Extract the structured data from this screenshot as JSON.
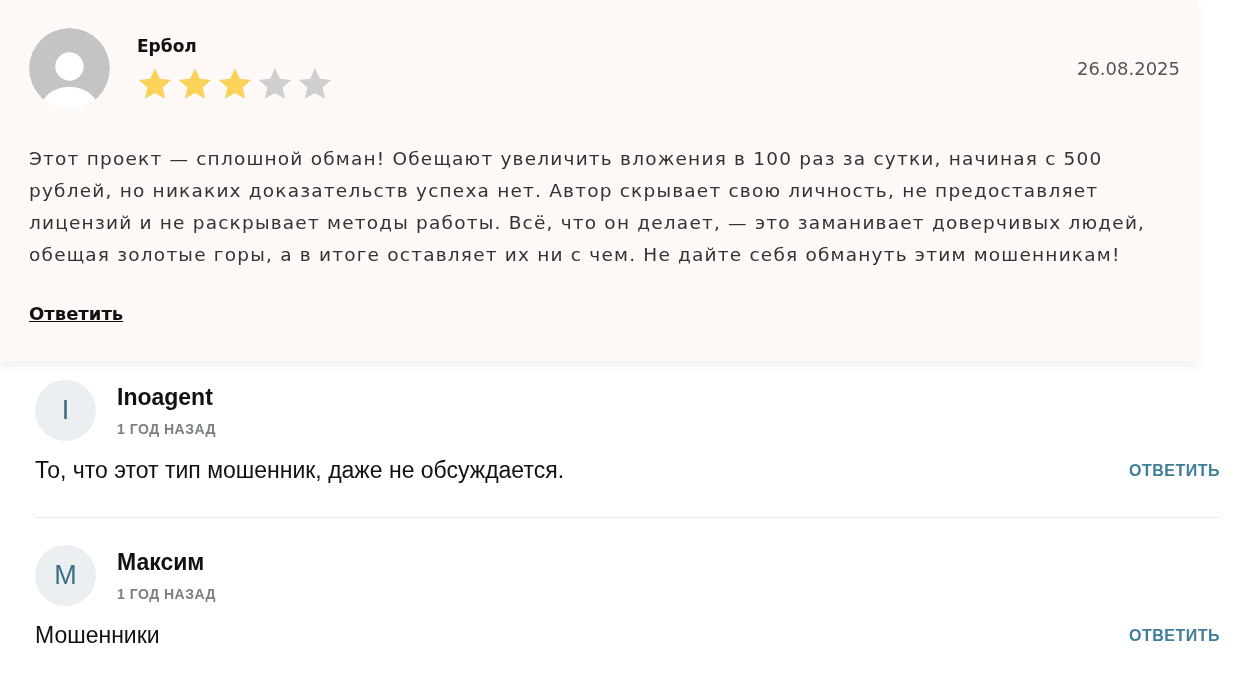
{
  "review": {
    "author": "Ербол",
    "stars": 3,
    "date": "26.08.2025",
    "text": "Этот проект — сплошной обман! Обещают увеличить вложения в 100 раз за сутки, начиная с 500 рублей, но никаких доказательств успеха нет. Автор скрывает свою личность, не предоставляет лицензий и не раскрывает методы работы. Всё, что он делает, — это заманивает доверчивых людей, обещая золотые горы, а в итоге оставляет их ни с чем. Не дайте себя обмануть этим мошенникам!",
    "reply": "Ответить"
  },
  "comments": [
    {
      "initial": "I",
      "author": "Inoagent",
      "time": "1 ГОД НАЗАД",
      "text": "То, что этот тип мошенник, даже не обсуждается.",
      "reply": "ОТВЕТИТЬ"
    },
    {
      "initial": "M",
      "author": "Максим",
      "time": "1 ГОД НАЗАД",
      "text": "Мошенники",
      "reply": "ОТВЕТИТЬ"
    }
  ]
}
